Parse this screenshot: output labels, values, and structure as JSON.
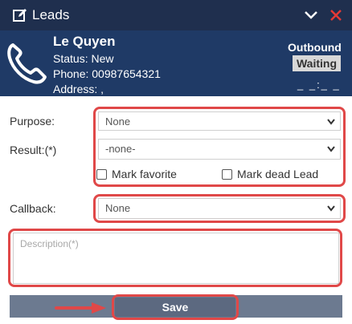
{
  "header": {
    "title": "Leads",
    "edit_icon": "edit-icon",
    "collapse_icon": "chevron-down-icon",
    "close_icon": "close-icon",
    "close_color": "#e53935"
  },
  "caller": {
    "name": "Le Quyen",
    "status": "Status: New",
    "phone": "Phone: 00987654321",
    "address": "Address: ,",
    "direction": "Outbound",
    "state": "Waiting",
    "timer": "_ _:_ _"
  },
  "form": {
    "purpose_label": "Purpose:",
    "purpose_value": "None",
    "result_label": "Result:(*)",
    "result_value": "-none-",
    "mark_favorite": "Mark favorite",
    "mark_dead": "Mark dead Lead",
    "callback_label": "Callback:",
    "callback_value": "None",
    "description_placeholder": "Description(*)",
    "save_label": "Save"
  },
  "colors": {
    "header_bg": "#1f2f4e",
    "caller_bg": "#1f3a66",
    "highlight": "#e04848",
    "save_bg": "#6c7a90"
  }
}
